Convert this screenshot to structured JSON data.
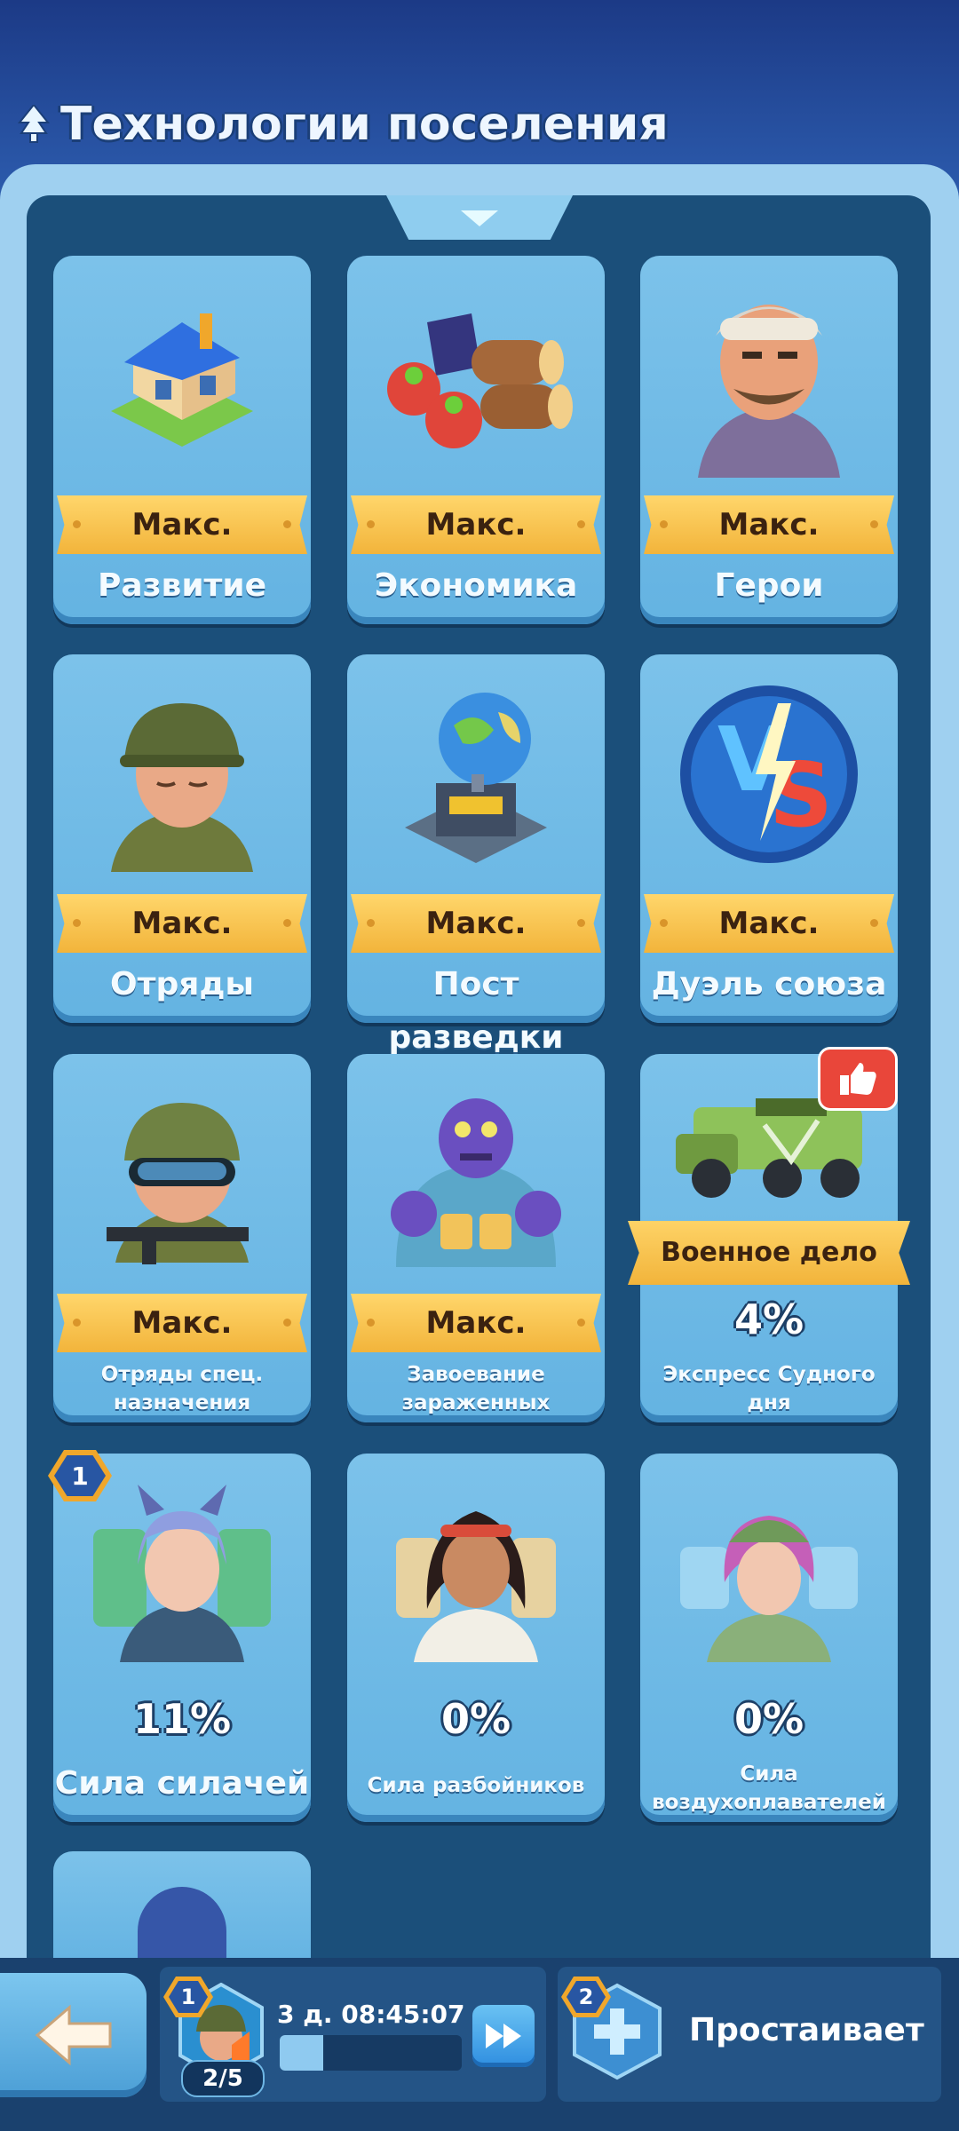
{
  "header": {
    "title": "Технологии поселения",
    "icon": "tree-up-icon"
  },
  "cards": [
    {
      "name": "Развитие",
      "status": "Макс.",
      "art": "house-icon"
    },
    {
      "name": "Экономика",
      "status": "Макс.",
      "art": "resources-icon"
    },
    {
      "name": "Герои",
      "status": "Макс.",
      "art": "hero-face-icon"
    },
    {
      "name": "Отряды",
      "status": "Макс.",
      "art": "soldier-icon"
    },
    {
      "name": "Пост разведки",
      "status": "Макс.",
      "art": "globe-station-icon"
    },
    {
      "name": "Дуэль союза",
      "status": "Макс.",
      "art": "vs-icon"
    },
    {
      "name": "Отряды спец. назначения",
      "status": "Макс.",
      "art": "special-forces-icon"
    },
    {
      "name": "Завоевание зараженных",
      "status": "Макс.",
      "art": "zombie-icon"
    },
    {
      "name": "Экспресс Судного дня",
      "ribbon": "Военное дело",
      "progress": "4%",
      "art": "armored-truck-icon",
      "recommended_icon": "thumbs-up-icon"
    },
    {
      "name": "Сила силачей",
      "progress": "11%",
      "badge": "1",
      "art": "fighter-girl-icon"
    },
    {
      "name": "Сила разбойников",
      "progress": "0%",
      "art": "bandit-girl-icon"
    },
    {
      "name": "Сила воздухоплавателей",
      "progress": "0%",
      "art": "aviator-girl-icon"
    }
  ],
  "bottom_bar": {
    "back_icon": "arrow-left-icon",
    "queue_badge": "1",
    "queue_count": "2/5",
    "timer": "3 д. 08:45:07",
    "progress": 0.24,
    "speedup_icon": "fast-forward-icon",
    "assist_badge": "2",
    "assist_label": "Простаивает",
    "assist_icon": "plus-icon"
  },
  "colors": {
    "accent_gold": "#f2b43b",
    "panel_blue": "#1b4f7a",
    "card_blue": "#7cc2ea"
  }
}
